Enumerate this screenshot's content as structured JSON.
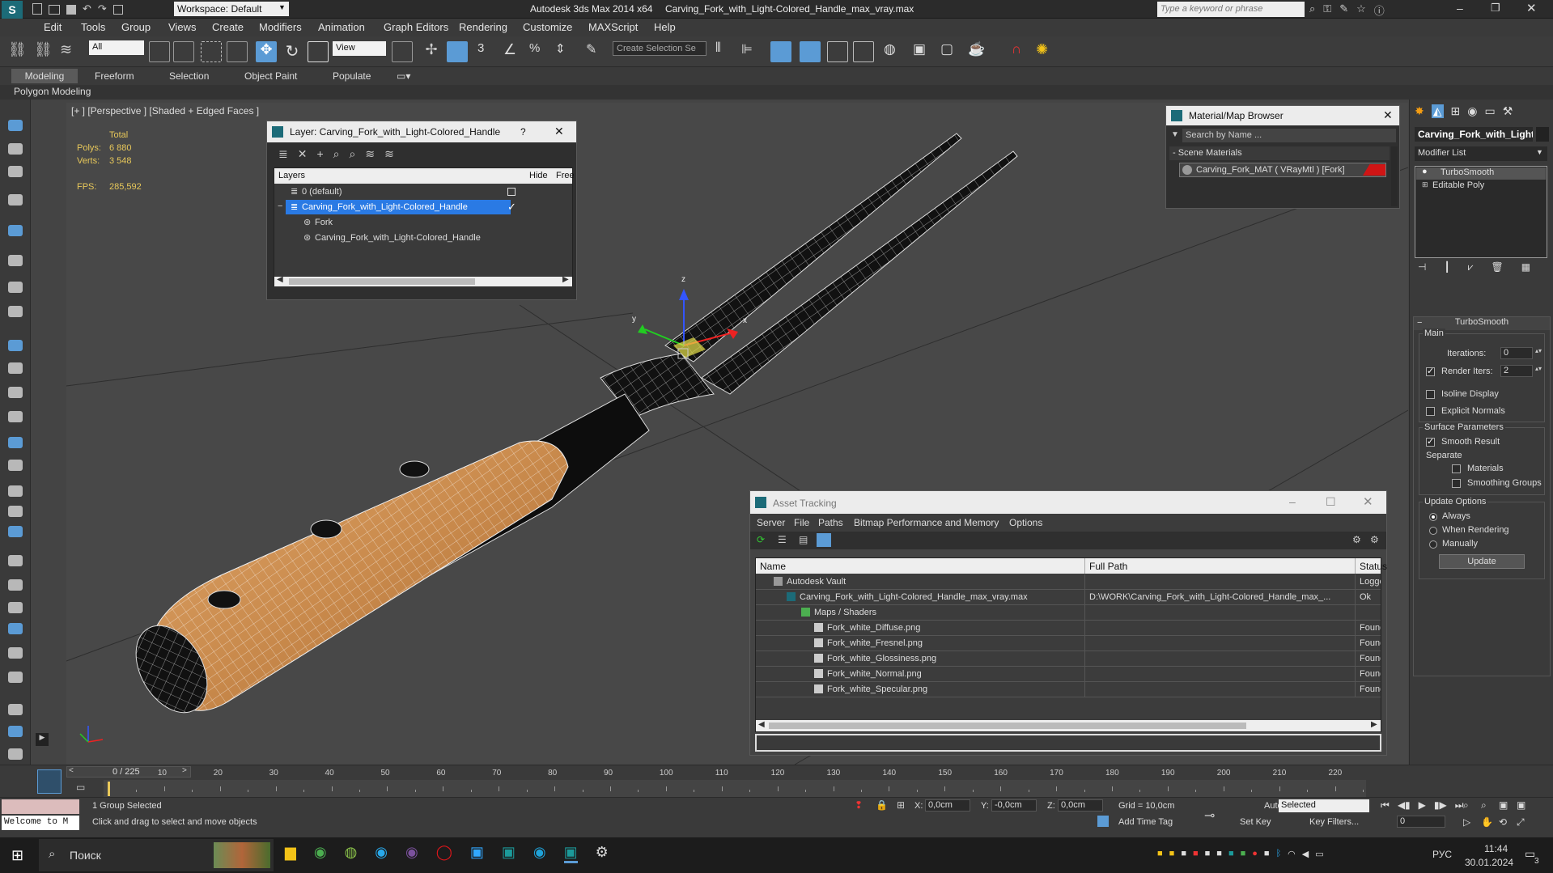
{
  "title": {
    "workspace": "Workspace: Default",
    "app": "Autodesk 3ds Max  2014 x64",
    "file": "Carving_Fork_with_Light-Colored_Handle_max_vray.max",
    "search_placeholder": "Type a keyword or phrase"
  },
  "menu": [
    "Edit",
    "Tools",
    "Group",
    "Views",
    "Create",
    "Modifiers",
    "Animation",
    "Graph Editors",
    "Rendering",
    "Customize",
    "MAXScript",
    "Help"
  ],
  "toolbar": {
    "selection_filter": "All",
    "ref_coord": "View",
    "named_selection": "Create Selection Se",
    "snap_3": "3",
    "snap_pct": "%"
  },
  "ribbon": {
    "tabs": [
      "Modeling",
      "Freeform",
      "Selection",
      "Object Paint",
      "Populate"
    ],
    "sub_label": "Polygon Modeling"
  },
  "viewport": {
    "label": "[+ ] [Perspective ] [Shaded + Edged Faces ]",
    "stats_header": "Total",
    "polys_label": "Polys:",
    "polys": "6 880",
    "verts_label": "Verts:",
    "verts": "3 548",
    "fps_label": "FPS:",
    "fps": "285,592",
    "gizmo": {
      "x": "x",
      "y": "y",
      "z": "z"
    }
  },
  "layer_dialog": {
    "title": "Layer: Carving_Fork_with_Light-Colored_Handle",
    "help": "?",
    "col_layers": "Layers",
    "col_hide": "Hide",
    "col_freeze": "Free",
    "rows": [
      {
        "label": "0 (default)",
        "selected": false
      },
      {
        "label": "Carving_Fork_with_Light-Colored_Handle",
        "selected": true
      },
      {
        "label": "Fork",
        "selected": false
      },
      {
        "label": "Carving_Fork_with_Light-Colored_Handle",
        "selected": false
      }
    ]
  },
  "material_browser": {
    "title": "Material/Map Browser",
    "search_placeholder": "Search by Name ...",
    "section": "- Scene Materials",
    "item": "Carving_Fork_MAT ( VRayMtl ) [Fork]",
    "item_color": "#d01515"
  },
  "asset_tracking": {
    "title": "Asset Tracking",
    "menu": [
      "Server",
      "File",
      "Paths",
      "Bitmap Performance and Memory",
      "Options"
    ],
    "columns": [
      "Name",
      "Full Path",
      "Status"
    ],
    "rows": [
      {
        "name": "Autodesk Vault",
        "path": "",
        "status": "Logge"
      },
      {
        "name": "Carving_Fork_with_Light-Colored_Handle_max_vray.max",
        "path": "D:\\WORK\\Carving_Fork_with_Light-Colored_Handle_max_...",
        "status": "Ok"
      },
      {
        "name": "Maps / Shaders",
        "path": "",
        "status": ""
      },
      {
        "name": "Fork_white_Diffuse.png",
        "path": "",
        "status": "Found"
      },
      {
        "name": "Fork_white_Fresnel.png",
        "path": "",
        "status": "Found"
      },
      {
        "name": "Fork_white_Glossiness.png",
        "path": "",
        "status": "Found"
      },
      {
        "name": "Fork_white_Normal.png",
        "path": "",
        "status": "Found"
      },
      {
        "name": "Fork_white_Specular.png",
        "path": "",
        "status": "Found"
      }
    ]
  },
  "command_panel": {
    "object_name": "Carving_Fork_with_Light",
    "modifier_list": "Modifier List",
    "stack": [
      "TurboSmooth",
      "Editable Poly"
    ],
    "rollout_title": "TurboSmooth",
    "main_label": "Main",
    "iterations_label": "Iterations:",
    "iterations": "0",
    "render_iters_label": "Render Iters:",
    "render_iters": "2",
    "isoline": "Isoline Display",
    "explicit_normals": "Explicit Normals",
    "surface_params": "Surface Parameters",
    "smooth_result": "Smooth Result",
    "separate": "Separate",
    "materials": "Materials",
    "smoothing_groups": "Smoothing Groups",
    "update_options": "Update Options",
    "always": "Always",
    "when_rendering": "When Rendering",
    "manually": "Manually",
    "update_button": "Update"
  },
  "timeline": {
    "frame": "0 / 225",
    "ticks": [
      "10",
      "20",
      "30",
      "40",
      "50",
      "60",
      "70",
      "80",
      "90",
      "100",
      "110",
      "120",
      "130",
      "140",
      "150",
      "160",
      "170",
      "180",
      "190",
      "200",
      "210",
      "220"
    ]
  },
  "status": {
    "maxscript": "Welcome to M",
    "selection": "1 Group Selected",
    "prompt": "Click and drag to select and move objects",
    "x_label": "X:",
    "x": "0,0cm",
    "y_label": "Y:",
    "y": "-0,0cm",
    "z_label": "Z:",
    "z": "0,0cm",
    "grid": "Grid = 10,0cm",
    "add_time_tag": "Add Time Tag",
    "auto_key": "Auto Key",
    "auto_key_mode": "Selected",
    "set_key": "Set Key",
    "key_filters": "Key Filters...",
    "frame_field": "0"
  },
  "taskbar": {
    "search": "Поиск",
    "lang": "РУС",
    "time": "11:44",
    "date": "30.01.2024",
    "notif": "3"
  }
}
